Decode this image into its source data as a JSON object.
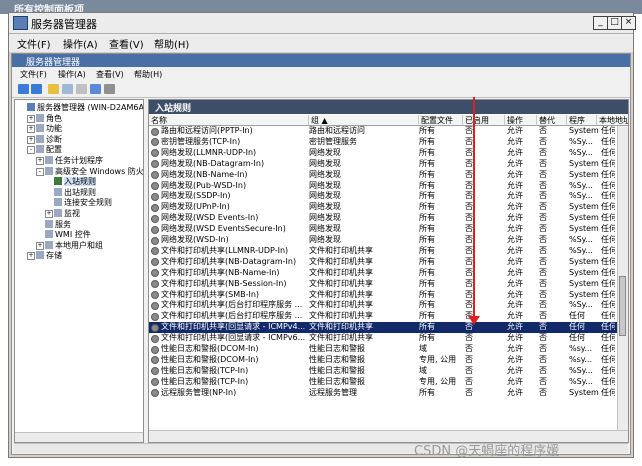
{
  "bg_title": "所有控制面板项",
  "window": {
    "title": "服务器管理器",
    "menu": [
      "文件(F)",
      "操作(A)",
      "查看(V)",
      "帮助(H)"
    ]
  },
  "inner": {
    "title": "服务器管理器",
    "menu": [
      "文件(F)",
      "操作(A)",
      "查看(V)",
      "帮助(H)"
    ]
  },
  "tree": [
    {
      "label": "服务器管理器 (WIN-D2AM6AFASV",
      "level": 0,
      "exp": ""
    },
    {
      "label": "角色",
      "level": 1,
      "exp": "+"
    },
    {
      "label": "功能",
      "level": 1,
      "exp": "+"
    },
    {
      "label": "诊断",
      "level": 1,
      "exp": "+"
    },
    {
      "label": "配置",
      "level": 1,
      "exp": "-"
    },
    {
      "label": "任务计划程序",
      "level": 2,
      "exp": "+"
    },
    {
      "label": "高级安全 Windows 防火墙",
      "level": 2,
      "exp": "-"
    },
    {
      "label": "入站规则",
      "level": 3,
      "exp": "",
      "sel": true
    },
    {
      "label": "出站规则",
      "level": 3,
      "exp": ""
    },
    {
      "label": "连接安全规则",
      "level": 3,
      "exp": ""
    },
    {
      "label": "监视",
      "level": 3,
      "exp": "+"
    },
    {
      "label": "服务",
      "level": 2,
      "exp": ""
    },
    {
      "label": "WMI 控件",
      "level": 2,
      "exp": ""
    },
    {
      "label": "本地用户和组",
      "level": 2,
      "exp": "+"
    },
    {
      "label": "存储",
      "level": 1,
      "exp": "+"
    }
  ],
  "list": {
    "header": "入站规则",
    "columns": [
      "名称",
      "组 ▲",
      "配置文件",
      "已启用",
      "操作",
      "替代",
      "程序",
      "本地地址"
    ],
    "rows": [
      [
        "路由和远程访问(PPTP-In)",
        "路由和远程访问",
        "所有",
        "否",
        "允许",
        "否",
        "System",
        "任何"
      ],
      [
        "密钥管理服务(TCP-In)",
        "密钥管理服务",
        "所有",
        "否",
        "允许",
        "否",
        "%Sy...",
        "任何"
      ],
      [
        "网络发现(LLMNR-UDP-In)",
        "网络发现",
        "所有",
        "否",
        "允许",
        "否",
        "%Sy...",
        "任何"
      ],
      [
        "网络发现(NB-Datagram-In)",
        "网络发现",
        "所有",
        "否",
        "允许",
        "否",
        "System",
        "任何"
      ],
      [
        "网络发现(NB-Name-In)",
        "网络发现",
        "所有",
        "否",
        "允许",
        "否",
        "System",
        "任何"
      ],
      [
        "网络发现(Pub-WSD-In)",
        "网络发现",
        "所有",
        "否",
        "允许",
        "否",
        "%Sy...",
        "任何"
      ],
      [
        "网络发现(SSDP-In)",
        "网络发现",
        "所有",
        "否",
        "允许",
        "否",
        "%Sy...",
        "任何"
      ],
      [
        "网络发现(UPnP-In)",
        "网络发现",
        "所有",
        "否",
        "允许",
        "否",
        "System",
        "任何"
      ],
      [
        "网络发现(WSD Events-In)",
        "网络发现",
        "所有",
        "否",
        "允许",
        "否",
        "System",
        "任何"
      ],
      [
        "网络发现(WSD EventsSecure-In)",
        "网络发现",
        "所有",
        "否",
        "允许",
        "否",
        "System",
        "任何"
      ],
      [
        "网络发现(WSD-In)",
        "网络发现",
        "所有",
        "否",
        "允许",
        "否",
        "%Sy...",
        "任何"
      ],
      [
        "文件和打印机共享(LLMNR-UDP-In)",
        "文件和打印机共享",
        "所有",
        "否",
        "允许",
        "否",
        "%Sy...",
        "任何"
      ],
      [
        "文件和打印机共享(NB-Datagram-In)",
        "文件和打印机共享",
        "所有",
        "否",
        "允许",
        "否",
        "System",
        "任何"
      ],
      [
        "文件和打印机共享(NB-Name-In)",
        "文件和打印机共享",
        "所有",
        "否",
        "允许",
        "否",
        "System",
        "任何"
      ],
      [
        "文件和打印机共享(NB-Session-In)",
        "文件和打印机共享",
        "所有",
        "否",
        "允许",
        "否",
        "System",
        "任何"
      ],
      [
        "文件和打印机共享(SMB-In)",
        "文件和打印机共享",
        "所有",
        "否",
        "允许",
        "否",
        "System",
        "任何"
      ],
      [
        "文件和打印机共享(后台打印程序服务 ...",
        "文件和打印机共享",
        "所有",
        "否",
        "允许",
        "否",
        "%Sy...",
        "任何"
      ],
      [
        "文件和打印机共享(后台打印程序服务 ...",
        "文件和打印机共享",
        "所有",
        "否",
        "允许",
        "否",
        "任何",
        "任何"
      ],
      [
        "文件和打印机共享(回显请求 - ICMPv4...",
        "文件和打印机共享",
        "所有",
        "否",
        "允许",
        "否",
        "任何",
        "任何"
      ],
      [
        "文件和打印机共享(回显请求 - ICMPv6...",
        "文件和打印机共享",
        "所有",
        "否",
        "允许",
        "否",
        "任何",
        "任何"
      ],
      [
        "性能日志和警报(DCOM-In)",
        "性能日志和警报",
        "域",
        "否",
        "允许",
        "否",
        "%sy...",
        "任何"
      ],
      [
        "性能日志和警报(DCOM-In)",
        "性能日志和警报",
        "专用, 公用",
        "否",
        "允许",
        "否",
        "%sy...",
        "任何"
      ],
      [
        "性能日志和警报(TCP-In)",
        "性能日志和警报",
        "域",
        "否",
        "允许",
        "否",
        "%Sy...",
        "任何"
      ],
      [
        "性能日志和警报(TCP-In)",
        "性能日志和警报",
        "专用, 公用",
        "否",
        "允许",
        "否",
        "%Sy...",
        "任何"
      ],
      [
        "远程服务管理(NP-In)",
        "远程服务管理",
        "所有",
        "否",
        "允许",
        "否",
        "System",
        "任何"
      ]
    ]
  },
  "watermark": "CSDN @天蝎座的程序媛"
}
